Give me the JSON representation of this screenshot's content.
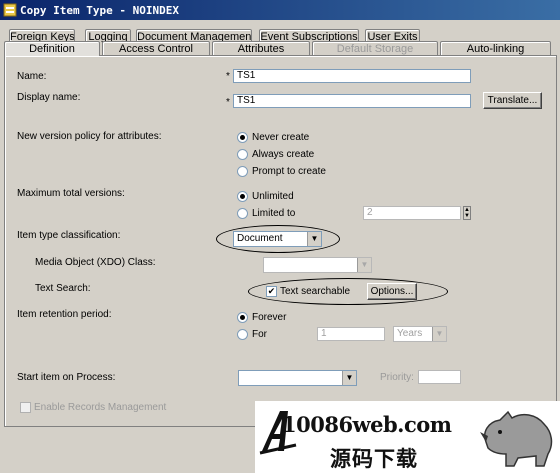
{
  "window": {
    "title": "Copy Item Type - NOINDEX"
  },
  "tabs_back": [
    "Foreign Keys",
    "Logging",
    "Document Management",
    "Event Subscriptions",
    "User Exits"
  ],
  "tabs_front": [
    "Definition",
    "Access Control",
    "Attributes",
    "Default Storage",
    "Auto-linking"
  ],
  "form": {
    "name_label": "Name:",
    "name_value": "TS1",
    "display_name_label": "Display name:",
    "display_name_value": "TS1",
    "required_mark": "*",
    "translate_button": "Translate...",
    "version_policy_label": "New version policy for attributes:",
    "version_options": [
      "Never create",
      "Always create",
      "Prompt to create"
    ],
    "version_selected": 0,
    "max_versions_label": "Maximum total versions:",
    "max_options": [
      "Unlimited",
      "Limited to"
    ],
    "max_selected": 0,
    "limited_value": "2",
    "classification_label": "Item type classification:",
    "classification_value": "Document",
    "media_object_label": "Media Object (XDO) Class:",
    "media_object_value": "",
    "text_search_label": "Text Search:",
    "text_searchable_label": "Text searchable",
    "text_searchable_checked": true,
    "options_button": "Options...",
    "retention_label": "Item retention period:",
    "retention_options": [
      "Forever",
      "For"
    ],
    "retention_selected": 0,
    "retention_value": "1",
    "retention_unit": "Years",
    "start_process_label": "Start item on Process:",
    "start_process_value": "",
    "priority_label": "Priority:",
    "priority_value": "",
    "records_mgmt_label": "Enable Records Management",
    "records_mgmt_checked": false
  },
  "watermark": {
    "line1": "10086web.com",
    "line2": "源码下载"
  },
  "colors": {
    "titlebar": "#0a246a",
    "dialog_bg": "#d4d0c8",
    "field_border": "#7f9db9"
  }
}
